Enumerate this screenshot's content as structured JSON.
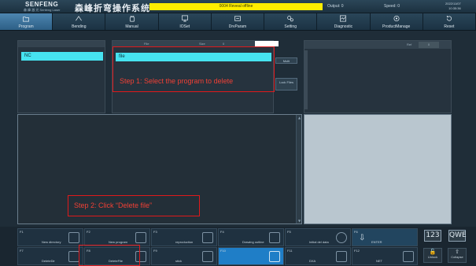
{
  "header": {
    "brand": "SENFENG",
    "brand_sub": "森 峰 激 光 Senfeng Laser",
    "system_name": "森峰折弯操作系统",
    "alarm_text": "0004 Reveal offline",
    "output_label": "Output: 0",
    "speed_label": "Speed: 0",
    "date": "2022/11/07",
    "time": "10:35:36"
  },
  "nav": {
    "tabs": [
      {
        "label": "Program",
        "icon": "folder-icon"
      },
      {
        "label": "Bending",
        "icon": "bending-icon"
      },
      {
        "label": "Manual",
        "icon": "hand-icon"
      },
      {
        "label": "IOSet",
        "icon": "monitor-icon"
      },
      {
        "label": "DrvParam",
        "icon": "drive-icon"
      },
      {
        "label": "Setting",
        "icon": "gears-icon"
      },
      {
        "label": "Diagnostic",
        "icon": "diagnostic-icon"
      },
      {
        "label": "ProductManage",
        "icon": "product-icon"
      },
      {
        "label": "Reset",
        "icon": "reset-icon"
      }
    ],
    "active_index": 0
  },
  "left_panel": {
    "header": "NC",
    "selected_item": "NC"
  },
  "file_panel": {
    "header_file": "File",
    "header_size": "Size",
    "header_count": "0",
    "selected_item": "file",
    "multi_button": "Multi",
    "lock_button": "Lock Files"
  },
  "right_panel": {
    "ref_label": "Ref",
    "ref_value": "0"
  },
  "fkeys": [
    {
      "num": "F1",
      "label": "New directory"
    },
    {
      "num": "F2",
      "label": "New program"
    },
    {
      "num": "F3",
      "label": "reproduction"
    },
    {
      "num": "F4",
      "label": "Drawing outline"
    },
    {
      "num": "F5",
      "label": "Initial del data"
    },
    {
      "num": "F6",
      "label": "ENTER"
    },
    {
      "num": "F7",
      "label": "DeleteDir"
    },
    {
      "num": "F8",
      "label": "DeleteFile"
    },
    {
      "num": "F9",
      "label": "stick"
    },
    {
      "num": "F10",
      "label": ""
    },
    {
      "num": "F11",
      "label": "DXA"
    },
    {
      "num": "F12",
      "label": "NET"
    }
  ],
  "side_keys": {
    "numeric": "123",
    "alpha": "QWE",
    "unlock": "Unlock",
    "collapse": "Collapse"
  },
  "annotations": {
    "step1": "Step 1: Select the program to delete",
    "step2": "Step 2: Click “Delete file”"
  },
  "colors": {
    "accent": "#46e3f0",
    "alarm": "#ffee00",
    "annotation": "#e0191b",
    "highlight_key": "#1f7ec7"
  }
}
